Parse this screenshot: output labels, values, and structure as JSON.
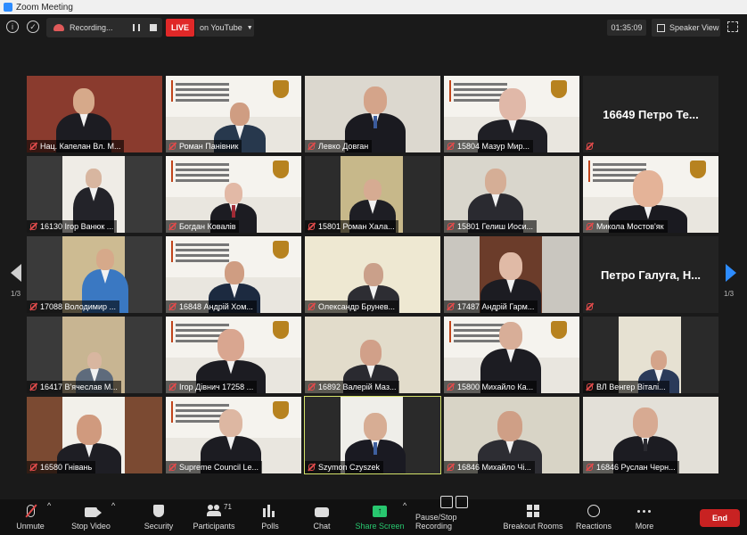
{
  "window": {
    "title": "Zoom Meeting"
  },
  "topbar": {
    "recording_label": "Recording...",
    "live_badge": "LIVE",
    "stream_target": "on YouTube",
    "elapsed_time": "01:35:09",
    "view_mode": "Speaker View"
  },
  "pager": {
    "left": "1/3",
    "right": "1/3"
  },
  "tiles": [
    "Нац. Капелан Вл. М...",
    "Роман Панівник",
    "Левко Довган",
    "15804 Мазур Мир...",
    "16649 Петро Те...",
    "16130 Ігор Ванюк ...",
    "Богдан Ковалів",
    "15801 Роман Хала...",
    "15801 Гелиш Иоси...",
    "Микола Мостов'як",
    "17088 Володимир ...",
    "16848 Андрій Хом...",
    "Олександр Брунев...",
    "17487 Андрій Гарм...",
    "Петро Галуга, Н...",
    "16417 В'ячеслав М...",
    "Ігор Дівнич 17258 ...",
    "16892 Валерій Маз...",
    "15800 Михайло Ка...",
    "ВЛ Венгер Віталі...",
    "16580 Гнівань",
    "Supreme Council Le...",
    "Szymon Czyszek",
    "16846 Михайло Чі...",
    "16846 Руслан Черн..."
  ],
  "toolbar": {
    "unmute": "Unmute",
    "stop_video": "Stop Video",
    "security": "Security",
    "participants": "Participants",
    "participants_count": "71",
    "polls": "Polls",
    "chat": "Chat",
    "share_screen": "Share Screen",
    "pause_stop_recording": "Pause/Stop Recording",
    "breakout_rooms": "Breakout Rooms",
    "reactions": "Reactions",
    "more": "More",
    "end": "End"
  },
  "colors": {
    "live": "#e02828",
    "share_green": "#28c76f",
    "end_red": "#c82222",
    "active_speaker": "#d4e26a",
    "nav_blue": "#2d8cff"
  }
}
